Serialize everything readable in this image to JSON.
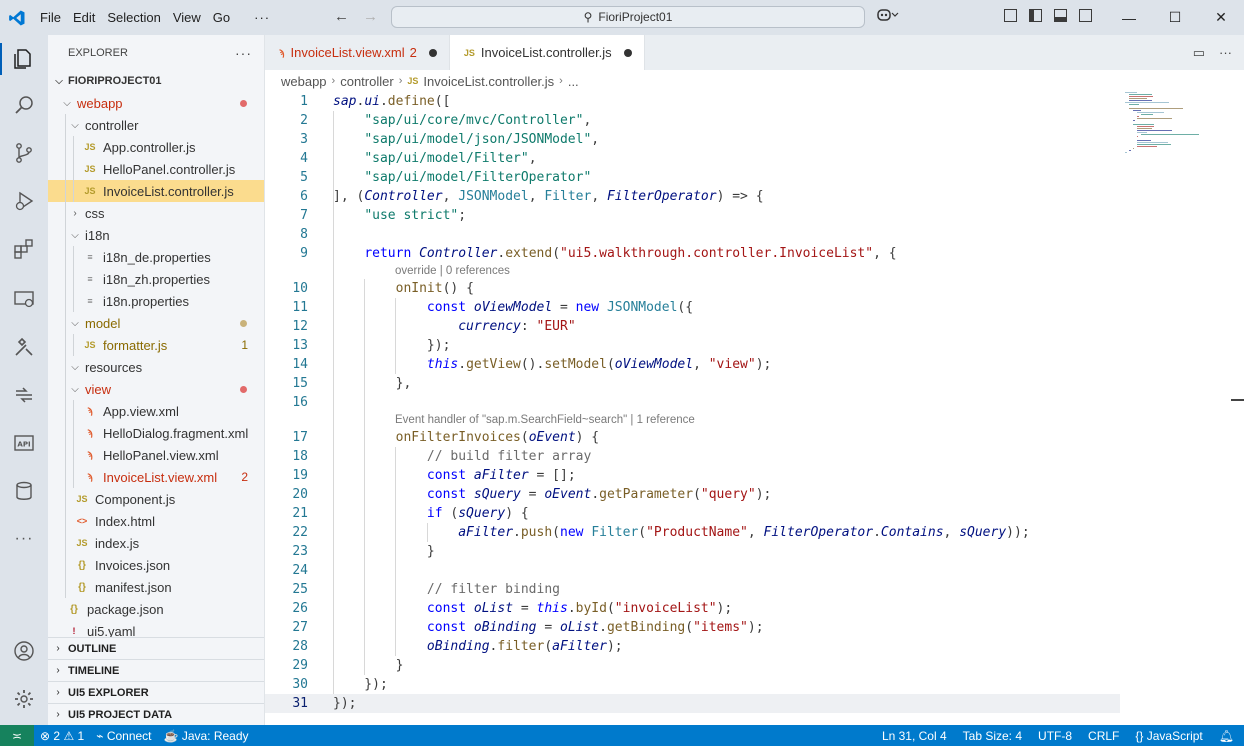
{
  "menu": {
    "file": "File",
    "edit": "Edit",
    "selection": "Selection",
    "view": "View",
    "go": "Go",
    "more": "···"
  },
  "search": {
    "text": "FioriProject01"
  },
  "explorer": {
    "title": "EXPLORER",
    "more": "···",
    "root": "FIORIPROJECT01"
  },
  "tree": [
    {
      "label": "webapp",
      "kind": "folder",
      "open": true,
      "depth": 1,
      "color": "red",
      "dot": "red"
    },
    {
      "label": "controller",
      "kind": "folder",
      "open": true,
      "depth": 2
    },
    {
      "label": "App.controller.js",
      "kind": "js",
      "depth": 3
    },
    {
      "label": "HelloPanel.controller.js",
      "kind": "js",
      "depth": 3
    },
    {
      "label": "InvoiceList.controller.js",
      "kind": "js",
      "depth": 3,
      "selected": true
    },
    {
      "label": "css",
      "kind": "folder",
      "open": false,
      "depth": 2
    },
    {
      "label": "i18n",
      "kind": "folder",
      "open": true,
      "depth": 2
    },
    {
      "label": "i18n_de.properties",
      "kind": "prop",
      "depth": 3
    },
    {
      "label": "i18n_zh.properties",
      "kind": "prop",
      "depth": 3
    },
    {
      "label": "i18n.properties",
      "kind": "prop",
      "depth": 3
    },
    {
      "label": "model",
      "kind": "folder",
      "open": true,
      "depth": 2,
      "color": "gold",
      "dot": "gold"
    },
    {
      "label": "formatter.js",
      "kind": "js",
      "depth": 3,
      "color": "gold",
      "badge": "1",
      "badgeColor": "gold"
    },
    {
      "label": "resources",
      "kind": "folder",
      "open": true,
      "depth": 2
    },
    {
      "label": "view",
      "kind": "folder",
      "open": true,
      "depth": 2,
      "color": "red",
      "dot": "red"
    },
    {
      "label": "App.view.xml",
      "kind": "xml",
      "depth": 3
    },
    {
      "label": "HelloDialog.fragment.xml",
      "kind": "xml",
      "depth": 3
    },
    {
      "label": "HelloPanel.view.xml",
      "kind": "xml",
      "depth": 3
    },
    {
      "label": "InvoiceList.view.xml",
      "kind": "xml",
      "depth": 3,
      "color": "red",
      "badge": "2",
      "badgeColor": "red"
    },
    {
      "label": "Component.js",
      "kind": "js",
      "depth": 2
    },
    {
      "label": "Index.html",
      "kind": "html",
      "depth": 2
    },
    {
      "label": "index.js",
      "kind": "js",
      "depth": 2
    },
    {
      "label": "Invoices.json",
      "kind": "json",
      "depth": 2
    },
    {
      "label": "manifest.json",
      "kind": "json",
      "depth": 2
    },
    {
      "label": "package.json",
      "kind": "json",
      "depth": 1
    },
    {
      "label": "ui5.yaml",
      "kind": "yaml",
      "depth": 1
    }
  ],
  "sections": [
    "OUTLINE",
    "TIMELINE",
    "UI5 EXPLORER",
    "UI5 PROJECT DATA"
  ],
  "tabs": [
    {
      "label": "InvoiceList.view.xml",
      "badge": "2",
      "icon": "xml-file-icon"
    },
    {
      "label": "InvoiceList.controller.js",
      "icon": "js-file-icon"
    }
  ],
  "breadcrumb": {
    "a": "webapp",
    "b": "controller",
    "c": "InvoiceList.controller.js",
    "d": "..."
  },
  "codelens": {
    "l9": "override | 0 references",
    "l16": "Event handler of \"sap.m.SearchField~search\" | 1 reference"
  },
  "code": [
    {
      "n": "1",
      "t": "sap.ui.define(["
    },
    {
      "n": "2",
      "t": "    \"sap/ui/core/mvc/Controller\","
    },
    {
      "n": "3",
      "t": "    \"sap/ui/model/json/JSONModel\","
    },
    {
      "n": "4",
      "t": "    \"sap/ui/model/Filter\","
    },
    {
      "n": "5",
      "t": "    \"sap/ui/model/FilterOperator\""
    },
    {
      "n": "6",
      "t": "], (Controller, JSONModel, Filter, FilterOperator) => {"
    },
    {
      "n": "7",
      "t": "    \"use strict\";"
    },
    {
      "n": "8",
      "t": ""
    },
    {
      "n": "9",
      "t": "    return Controller.extend(\"ui5.walkthrough.controller.InvoiceList\", {"
    },
    {
      "n": "10",
      "t": "        onInit() {"
    },
    {
      "n": "11",
      "t": "            const oViewModel = new JSONModel({"
    },
    {
      "n": "12",
      "t": "                currency: \"EUR\""
    },
    {
      "n": "13",
      "t": "            });"
    },
    {
      "n": "14",
      "t": "            this.getView().setModel(oViewModel, \"view\");"
    },
    {
      "n": "15",
      "t": "        },"
    },
    {
      "n": "16",
      "t": ""
    },
    {
      "n": "17",
      "t": "        onFilterInvoices(oEvent) {"
    },
    {
      "n": "18",
      "t": "            // build filter array"
    },
    {
      "n": "19",
      "t": "            const aFilter = [];"
    },
    {
      "n": "20",
      "t": "            const sQuery = oEvent.getParameter(\"query\");"
    },
    {
      "n": "21",
      "t": "            if (sQuery) {"
    },
    {
      "n": "22",
      "t": "                aFilter.push(new Filter(\"ProductName\", FilterOperator.Contains, sQuery));"
    },
    {
      "n": "23",
      "t": "            }"
    },
    {
      "n": "24",
      "t": ""
    },
    {
      "n": "25",
      "t": "            // filter binding"
    },
    {
      "n": "26",
      "t": "            const oList = this.byId(\"invoiceList\");"
    },
    {
      "n": "27",
      "t": "            const oBinding = oList.getBinding(\"items\");"
    },
    {
      "n": "28",
      "t": "            oBinding.filter(aFilter);"
    },
    {
      "n": "29",
      "t": "        }"
    },
    {
      "n": "30",
      "t": "    });"
    },
    {
      "n": "31",
      "t": "});"
    }
  ],
  "status": {
    "problems": "2",
    "warnings": "1",
    "connect": "Connect",
    "java": "Java: Ready",
    "position": "Ln 31, Col 4",
    "tabsize": "Tab Size: 4",
    "encoding": "UTF-8",
    "eol": "CRLF",
    "language": "JavaScript"
  },
  "colors": {
    "accent": "#007acc",
    "selection": "#fbdc8e",
    "error": "#c72e0f"
  }
}
